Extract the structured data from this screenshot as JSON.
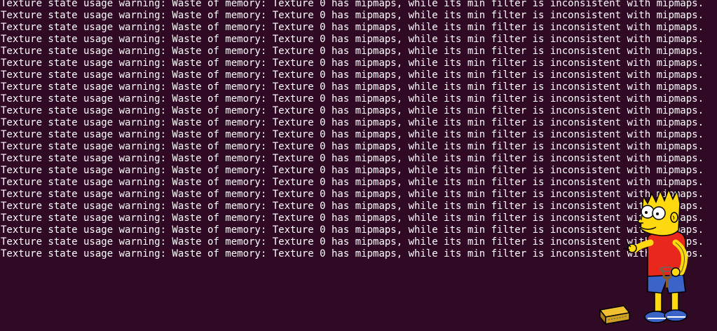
{
  "terminal": {
    "background_color": "#300a24",
    "text_color": "#ffffff",
    "lines": [
      "Texture state usage warning: Waste of memory: Texture 0 has mipmaps, while its min filter is inconsistent with mipmaps.",
      "Texture state usage warning: Waste of memory: Texture 0 has mipmaps, while its min filter is inconsistent with mipmaps.",
      "Texture state usage warning: Waste of memory: Texture 0 has mipmaps, while its min filter is inconsistent with mipmaps.",
      "Texture state usage warning: Waste of memory: Texture 0 has mipmaps, while its min filter is inconsistent with mipmaps.",
      "Texture state usage warning: Waste of memory: Texture 0 has mipmaps, while its min filter is inconsistent with mipmaps.",
      "Texture state usage warning: Waste of memory: Texture 0 has mipmaps, while its min filter is inconsistent with mipmaps.",
      "Texture state usage warning: Waste of memory: Texture 0 has mipmaps, while its min filter is inconsistent with mipmaps.",
      "Texture state usage warning: Waste of memory: Texture 0 has mipmaps, while its min filter is inconsistent with mipmaps.",
      "Texture state usage warning: Waste of memory: Texture 0 has mipmaps, while its min filter is inconsistent with mipmaps.",
      "Texture state usage warning: Waste of memory: Texture 0 has mipmaps, while its min filter is inconsistent with mipmaps.",
      "Texture state usage warning: Waste of memory: Texture 0 has mipmaps, while its min filter is inconsistent with mipmaps.",
      "Texture state usage warning: Waste of memory: Texture 0 has mipmaps, while its min filter is inconsistent with mipmaps.",
      "Texture state usage warning: Waste of memory: Texture 0 has mipmaps, while its min filter is inconsistent with mipmaps.",
      "Texture state usage warning: Waste of memory: Texture 0 has mipmaps, while its min filter is inconsistent with mipmaps.",
      "Texture state usage warning: Waste of memory: Texture 0 has mipmaps, while its min filter is inconsistent with mipmaps.",
      "Texture state usage warning: Waste of memory: Texture 0 has mipmaps, while its min filter is inconsistent with mipmaps.",
      "Texture state usage warning: Waste of memory: Texture 0 has mipmaps, while its min filter is inconsistent with mipmaps.",
      "Texture state usage warning: Waste of memory: Texture 0 has mipmaps, while its min filter is inconsistent with mipmaps.",
      "Texture state usage warning: Waste of memory: Texture 0 has mipmaps, while its min filter is inconsistent with mipmaps.",
      "Texture state usage warning: Waste of memory: Texture 0 has mipmaps, while its min filter is inconsistent with mipmaps.",
      "Texture state usage warning: Waste of memory: Texture 0 has mipmaps, while its min filter is inconsistent with mipmaps.",
      "Texture state usage warning: Waste of memory: Texture 0 has mipmaps, while its min filter is inconsistent with mipmaps."
    ]
  },
  "overlay": {
    "icon": "bart-simpson-with-slingshot-icon",
    "skin_color": "#ffd90f",
    "shirt_color": "#e8281c",
    "shorts_color": "#3a64c8",
    "shoe_color": "#3a64c8"
  }
}
